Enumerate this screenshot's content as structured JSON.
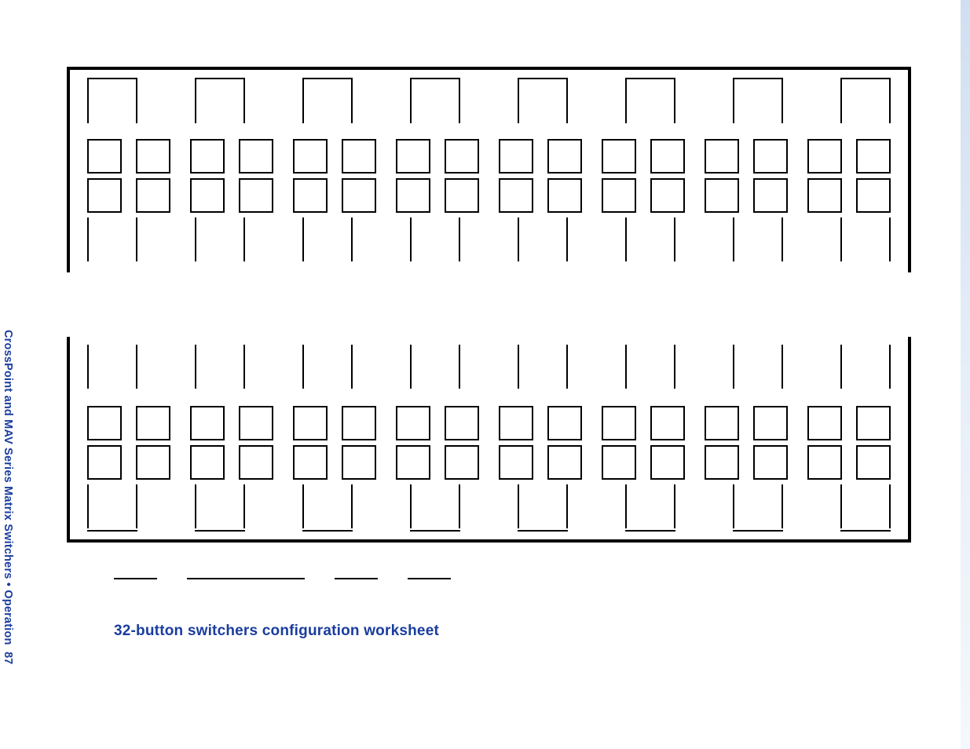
{
  "sidebar": {
    "running_head": "CrossPoint and MAV Series Matrix Switchers • Operation",
    "page_number": "87"
  },
  "worksheet": {
    "title": "32-button switchers configuration worksheet",
    "blocks": [
      {
        "tick_groups_top": 8,
        "ticks_per_group": 2,
        "button_pairs_top_row": 8,
        "buttons_per_pair": 2,
        "button_pairs_bottom_row": 8,
        "tick_groups_bottom": 8
      },
      {
        "tick_groups_top": 8,
        "ticks_per_group": 2,
        "button_pairs_top_row": 8,
        "buttons_per_pair": 2,
        "button_pairs_bottom_row": 8,
        "tick_groups_bottom": 8
      }
    ],
    "fields": [
      "",
      "",
      "",
      ""
    ]
  },
  "colors": {
    "accent": "#1a3d9e",
    "line": "#000000"
  }
}
